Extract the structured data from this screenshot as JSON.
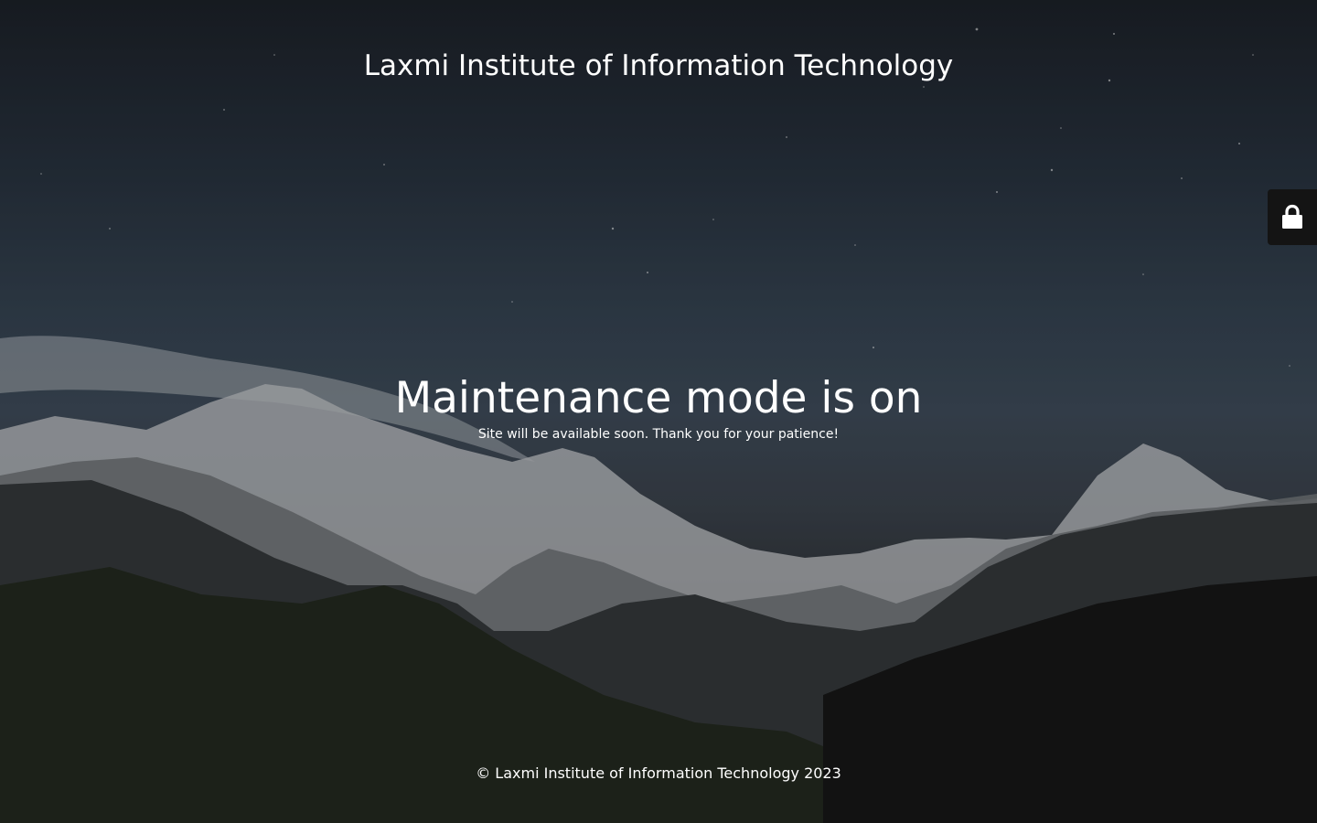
{
  "header": {
    "site_title": "Laxmi Institute of Information Technology"
  },
  "main": {
    "headline": "Maintenance mode is on",
    "message": "Site will be available soon. Thank you for your patience!"
  },
  "footer": {
    "copyright": "© Laxmi Institute of Information Technology 2023"
  },
  "login_tab": {
    "icon": "lock-icon"
  },
  "colors": {
    "text": "#ffffff",
    "login_tab_bg": "#141414"
  }
}
